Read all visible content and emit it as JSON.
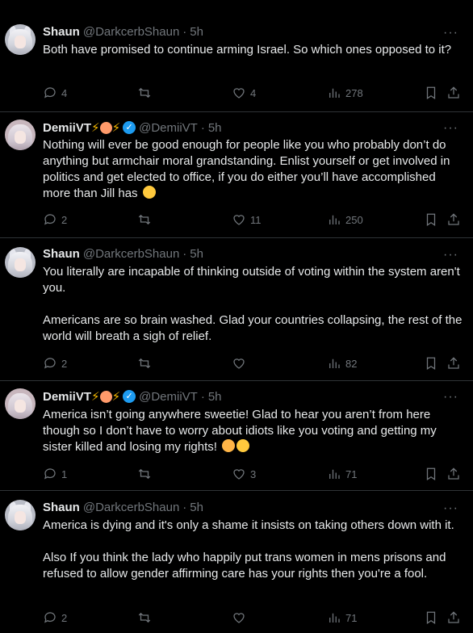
{
  "tweets": [
    {
      "name": "Shaun",
      "handle": "@DarkcerbShaun",
      "time": "5h",
      "text": [
        "Both have promised to continue arming Israel. So which ones opposed to it?"
      ],
      "replies": "4",
      "retweets": "",
      "likes": "4",
      "views": "278"
    },
    {
      "name": "DemiiVT",
      "handle": "@DemiiVT",
      "time": "5h",
      "text": [
        "Nothing will ever be good enough for people like you who probably don’t do anything but armchair moral grandstanding. Enlist yourself or get involved in politics and get elected to office, if you do either you’ll have accomplished more than Jill has"
      ],
      "replies": "2",
      "retweets": "",
      "likes": "11",
      "views": "250"
    },
    {
      "name": "Shaun",
      "handle": "@DarkcerbShaun",
      "time": "5h",
      "text": [
        "You literally are incapable of thinking outside of voting within the system aren't you.",
        "Americans are so brain washed. Glad your countries collapsing, the rest of the world will breath a sigh of relief."
      ],
      "replies": "2",
      "retweets": "",
      "likes": "",
      "views": "82"
    },
    {
      "name": "DemiiVT",
      "handle": "@DemiiVT",
      "time": "5h",
      "text": [
        "America isn’t going anywhere sweetie! Glad to hear you aren’t from here though so I don’t have to worry about idiots like you voting and getting my sister killed and losing my rights!"
      ],
      "replies": "1",
      "retweets": "",
      "likes": "3",
      "views": "71"
    },
    {
      "name": "Shaun",
      "handle": "@DarkcerbShaun",
      "time": "5h",
      "text": [
        "America is dying and it's only a shame it insists on taking others down with it.",
        "Also If you think the lady who happily put trans women in mens prisons and refused to allow gender affirming care has your rights then you're a fool."
      ],
      "replies": "2",
      "retweets": "",
      "likes": "",
      "views": "71"
    }
  ],
  "ui": {
    "more": "···",
    "dot": "·",
    "verified_mark": "✓",
    "bolt": "⚡"
  }
}
